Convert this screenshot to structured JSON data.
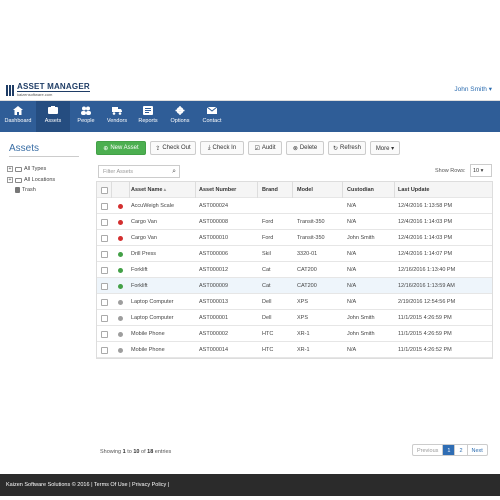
{
  "header": {
    "logo_title": "ASSET MANAGER",
    "logo_subtitle": "kaizensoftware.com",
    "user_menu": "John Smith ▾"
  },
  "nav": [
    {
      "label": "Dashboard",
      "icon": "home-icon"
    },
    {
      "label": "Assets",
      "icon": "assets-icon"
    },
    {
      "label": "People",
      "icon": "people-icon"
    },
    {
      "label": "Vendors",
      "icon": "truck-icon"
    },
    {
      "label": "Reports",
      "icon": "reports-icon"
    },
    {
      "label": "Options",
      "icon": "gear-icon"
    },
    {
      "label": "Contact",
      "icon": "envelope-icon"
    }
  ],
  "sidebar": {
    "title": "Assets",
    "tree": [
      {
        "label": "All Types",
        "toggle": "+",
        "icon": "folder-icon"
      },
      {
        "label": "All Locations",
        "toggle": "+",
        "icon": "folder-icon"
      },
      {
        "label": "Trash",
        "toggle": "",
        "icon": "trash-icon"
      }
    ]
  },
  "toolbar": {
    "new_asset": "New Asset",
    "check_out": "Check Out",
    "check_in": "Check In",
    "audit": "Audit",
    "delete": "Delete",
    "refresh": "Refresh",
    "more": "More ▾"
  },
  "filter": {
    "placeholder": "Filter Assets",
    "show_rows_label": "Show Rows:",
    "show_rows_value": "10 ▾"
  },
  "table": {
    "columns": [
      "Asset Name",
      "Asset Number",
      "Brand",
      "Model",
      "Custodian",
      "Last Update"
    ],
    "rows": [
      {
        "status": "#d32f2f",
        "name": "AccuWeigh Scale",
        "number": "AST000024",
        "brand": "",
        "model": "",
        "custodian": "N/A",
        "updated": "12/4/2016 1:13:58 PM"
      },
      {
        "status": "#d32f2f",
        "name": "Cargo Van",
        "number": "AST000008",
        "brand": "Ford",
        "model": "Transit-350",
        "custodian": "N/A",
        "updated": "12/4/2016 1:14:03 PM"
      },
      {
        "status": "#d32f2f",
        "name": "Cargo Van",
        "number": "AST000010",
        "brand": "Ford",
        "model": "Transit-350",
        "custodian": "John Smith",
        "updated": "12/4/2016 1:14:03 PM"
      },
      {
        "status": "#43a047",
        "name": "Drill Press",
        "number": "AST000006",
        "brand": "Skil",
        "model": "3320-01",
        "custodian": "N/A",
        "updated": "12/4/2016 1:14:07 PM"
      },
      {
        "status": "#43a047",
        "name": "Forklift",
        "number": "AST000012",
        "brand": "Cat",
        "model": "CAT200",
        "custodian": "N/A",
        "updated": "12/16/2016 1:13:40 PM"
      },
      {
        "status": "#43a047",
        "name": "Forklift",
        "number": "AST000009",
        "brand": "Cat",
        "model": "CAT200",
        "custodian": "N/A",
        "updated": "12/16/2016 1:13:59 AM"
      },
      {
        "status": "#9e9e9e",
        "name": "Laptop Computer",
        "number": "AST000013",
        "brand": "Dell",
        "model": "XPS",
        "custodian": "N/A",
        "updated": "2/19/2016 12:54:56 PM"
      },
      {
        "status": "#9e9e9e",
        "name": "Laptop Computer",
        "number": "AST000001",
        "brand": "Dell",
        "model": "XPS",
        "custodian": "John Smith",
        "updated": "11/1/2015 4:26:59 PM"
      },
      {
        "status": "#9e9e9e",
        "name": "Mobile Phone",
        "number": "AST000002",
        "brand": "HTC",
        "model": "XR-1",
        "custodian": "John Smith",
        "updated": "11/1/2015 4:26:59 PM"
      },
      {
        "status": "#9e9e9e",
        "name": "Mobile Phone",
        "number": "AST000014",
        "brand": "HTC",
        "model": "XR-1",
        "custodian": "N/A",
        "updated": "11/1/2015 4:26:52 PM"
      }
    ],
    "highlighted_row": 5
  },
  "pagination": {
    "showing_prefix": "Showing",
    "from": "1",
    "to_word": "to",
    "to": "10",
    "of_word": "of",
    "total": "18",
    "suffix": "entries",
    "previous": "Previous",
    "pages": [
      "1",
      "2"
    ],
    "next": "Next"
  },
  "footer": {
    "text": "Kaizen Software Solutions © 2016 | Terms Of Use | Privacy Policy |"
  },
  "colors": {
    "nav_bg": "#2f5d97",
    "accent_green": "#4caf50",
    "footer_bg": "#2b2b2b"
  }
}
